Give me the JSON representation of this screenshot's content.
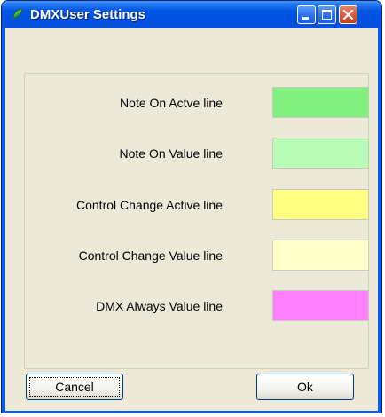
{
  "window": {
    "title": "DMXUser Settings",
    "controls": [
      "minimize-icon",
      "maximize-icon",
      "close-icon"
    ]
  },
  "settings": {
    "rows": [
      {
        "label": "Note On Actve line",
        "color": "#80f080"
      },
      {
        "label": "Note On Value line",
        "color": "#b8fcb8"
      },
      {
        "label": "Control Change Active line",
        "color": "#ffff80"
      },
      {
        "label": "Control Change Value line",
        "color": "#ffffc8"
      },
      {
        "label": "DMX Always Value line",
        "color": "#ff80ff"
      }
    ]
  },
  "buttons": {
    "cancel_label": "Cancel",
    "ok_label": "Ok"
  },
  "colors": {
    "title_bar": "#0055e5",
    "dialog_background": "#ece9d8"
  }
}
